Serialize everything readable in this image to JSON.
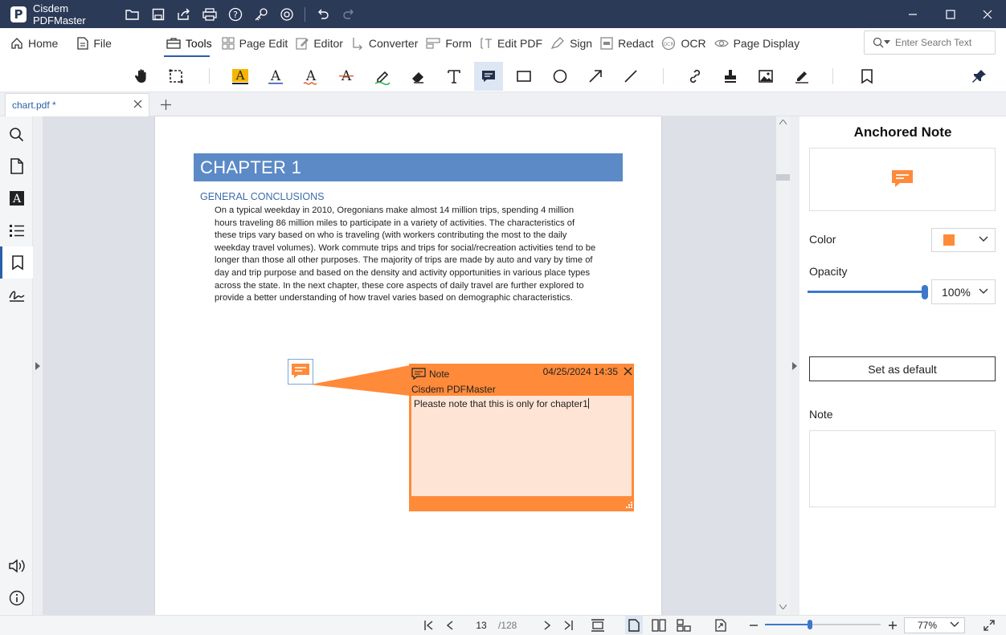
{
  "app": {
    "title": "Cisdem PDFMaster",
    "logo_letter": "P"
  },
  "menu": {
    "items": [
      {
        "key": "home",
        "label": "Home",
        "icon": "home-icon"
      },
      {
        "key": "file",
        "label": "File",
        "icon": "file-icon"
      },
      {
        "key": "tools",
        "label": "Tools",
        "icon": "toolbox-icon"
      },
      {
        "key": "page_edit",
        "label": "Page Edit",
        "icon": "grid-icon"
      },
      {
        "key": "editor",
        "label": "Editor",
        "icon": "edit-icon"
      },
      {
        "key": "converter",
        "label": "Converter",
        "icon": "convert-icon"
      },
      {
        "key": "form",
        "label": "Form",
        "icon": "form-icon"
      },
      {
        "key": "edit_pdf",
        "label": "Edit PDF",
        "icon": "text-cursor-icon"
      },
      {
        "key": "sign",
        "label": "Sign",
        "icon": "sign-icon"
      },
      {
        "key": "redact",
        "label": "Redact",
        "icon": "redact-icon"
      },
      {
        "key": "ocr",
        "label": "OCR",
        "icon": "ocr-icon"
      },
      {
        "key": "page_display",
        "label": "Page Display",
        "icon": "eye-icon"
      }
    ],
    "search_placeholder": "Enter Search Text"
  },
  "tab": {
    "name": "chart.pdf *"
  },
  "document": {
    "chapter": "CHAPTER 1",
    "section": "GENERAL CONCLUSIONS",
    "lines": [
      "On a typical weekday in 2010, Oregonians make almost 14 million trips, spending 4 million",
      "hours traveling 86 million miles to participate in a variety of activities. The characteristics of",
      "these trips vary based on who is traveling (with workers contributing the most to the daily",
      "weekday travel volumes). Work commute trips and trips for social/recreation activities tend to be",
      "longer than those all other purposes. The majority of trips are made by auto and vary by time of",
      "day and trip purpose and based on the density and activity opportunities in various place types",
      "across the state. In the next chapter, these core aspects of daily travel are further explored to",
      "provide a better understanding of how travel varies based on demographic characteristics."
    ]
  },
  "note": {
    "title": "Note",
    "date": "04/25/2024 14:35",
    "author": "Cisdem PDFMaster",
    "content": "Pleaste note that this is only for chapter1",
    "color": "#ff8a3a"
  },
  "panel": {
    "title": "Anchored Note",
    "color_label": "Color",
    "opacity_label": "Opacity",
    "opacity_value": "100%",
    "opacity_fraction": 1.0,
    "set_default_label": "Set as default",
    "note_label": "Note"
  },
  "status": {
    "current_page": "13",
    "total_pages": "/128",
    "zoom": "77%",
    "zoom_fraction": 0.39
  },
  "colors": {
    "titlebar": "#2b3a57",
    "accent": "#2b5ea8",
    "chapter_bar": "#5b8ac6",
    "note": "#ff8a3a"
  }
}
